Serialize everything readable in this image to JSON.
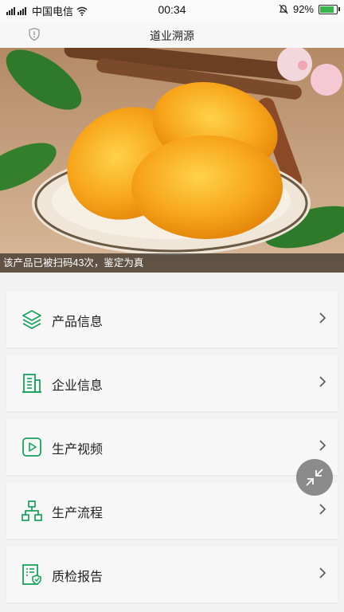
{
  "status_bar": {
    "carrier": "中国电信",
    "time": "00:34",
    "battery": "92%",
    "battery_level": 0.92
  },
  "navbar": {
    "title": "道业溯源"
  },
  "hero": {
    "caption": "该产品已被扫码43次，鉴定为真"
  },
  "menu": [
    {
      "label": "产品信息",
      "icon": "layers-icon"
    },
    {
      "label": "企业信息",
      "icon": "building-icon"
    },
    {
      "label": "生产视频",
      "icon": "video-play-icon"
    },
    {
      "label": "生产流程",
      "icon": "org-chart-icon"
    },
    {
      "label": "质检报告",
      "icon": "report-shield-icon"
    }
  ],
  "colors": {
    "accent": "#1aa260"
  }
}
